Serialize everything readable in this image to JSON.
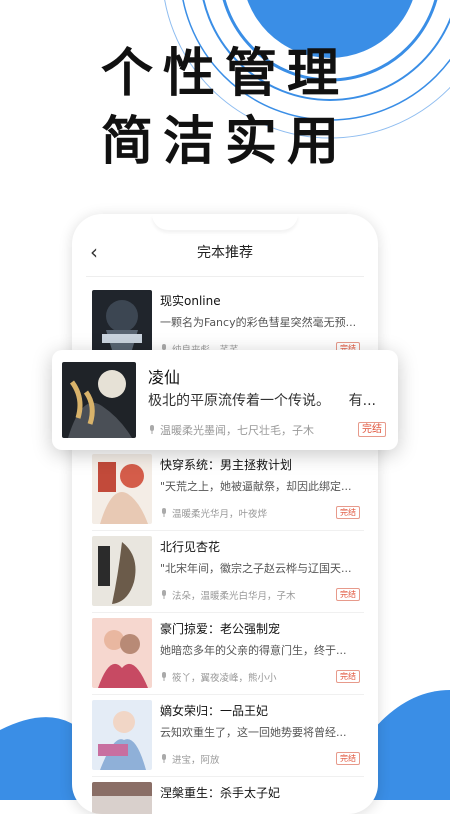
{
  "headline": {
    "line1": "个性管理",
    "line2": "简洁实用"
  },
  "nav": {
    "back_icon": "chevron-left",
    "title": "完本推荐"
  },
  "books": [
    {
      "title": "现实online",
      "desc": "一颗名为Fancy的彩色彗星突然毫无预...",
      "narrators": "纯良丧彪，芊芊",
      "status": "完结"
    },
    {
      "title": "凌仙",
      "desc": "极北的平原流传着一个传说。",
      "desc_tail": "有...",
      "narrators": "温暖柔光墨闻，七尺壮毛，子木",
      "status": "完结"
    },
    {
      "title": "快穿系统：男主拯救计划",
      "desc": "\"天荒之上，她被逼献祭，却因此绑定...",
      "narrators": "温暖柔光华月，叶夜烨",
      "status": "完结"
    },
    {
      "title": "北行见杏花",
      "desc": "\"北宋年间，徽宗之子赵云桦与辽国天...",
      "narrators": "法朵，温暖柔光白华月，子木",
      "status": "完结"
    },
    {
      "title": "豪门掠爱：老公强制宠",
      "desc": "她暗恋多年的父亲的得意门生，终于...",
      "narrators": "筱丫，翼夜凌峰，熊小小",
      "status": "完结"
    },
    {
      "title": "嫡女荣归：一品王妃",
      "desc": "云知欢重生了，这一回她势要将曾经...",
      "narrators": "进宝，阿放",
      "status": "完结"
    },
    {
      "title": "涅槃重生：杀手太子妃",
      "desc": "",
      "narrators": "",
      "status": ""
    }
  ],
  "colors": {
    "accent": "#3a8ee6",
    "badge": "#e0533a"
  }
}
